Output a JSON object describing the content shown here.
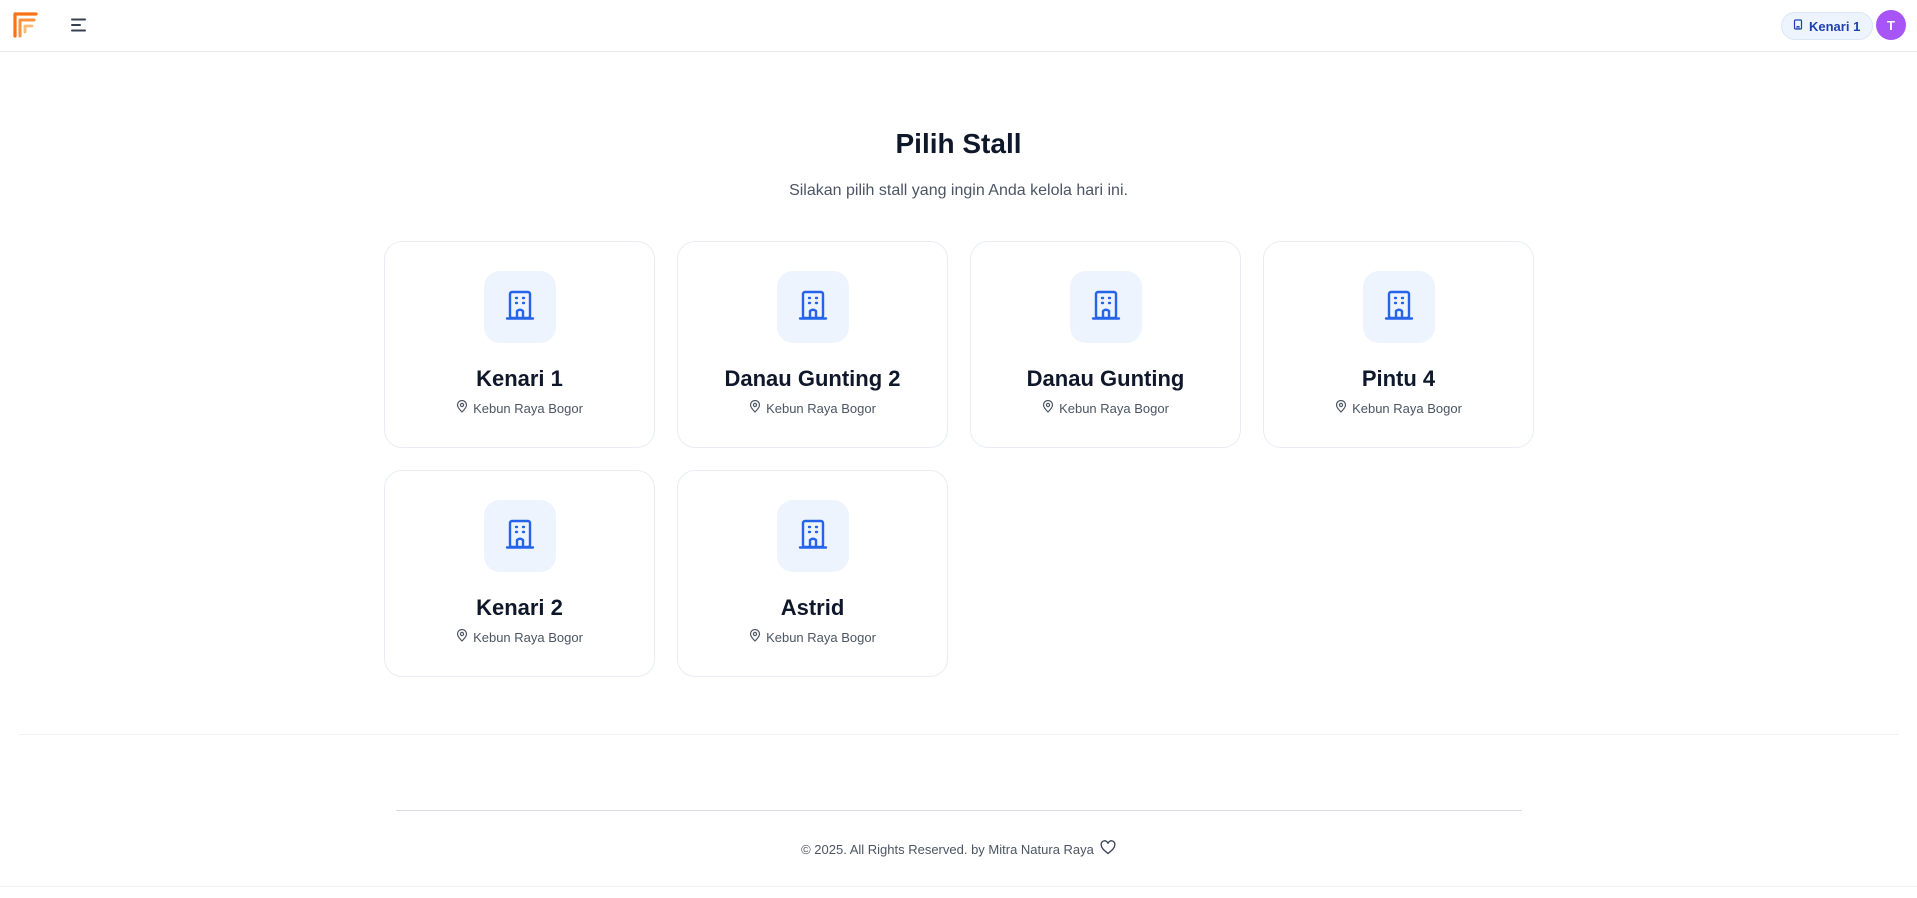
{
  "header": {
    "current_stall": "Kenari 1",
    "avatar_initial": "T"
  },
  "main": {
    "title": "Pilih Stall",
    "subtitle": "Silakan pilih stall yang ingin Anda kelola hari ini."
  },
  "stalls": [
    {
      "name": "Kenari 1",
      "location": "Kebun Raya Bogor"
    },
    {
      "name": "Danau Gunting 2",
      "location": "Kebun Raya Bogor"
    },
    {
      "name": "Danau Gunting",
      "location": "Kebun Raya Bogor"
    },
    {
      "name": "Pintu 4",
      "location": "Kebun Raya Bogor"
    },
    {
      "name": "Kenari 2",
      "location": "Kebun Raya Bogor"
    },
    {
      "name": "Astrid",
      "location": "Kebun Raya Bogor"
    }
  ],
  "footer": {
    "text": "© 2025. All Rights Reserved. by Mitra Natura Raya"
  },
  "icons": {
    "logo": "brand-logo-icon",
    "menu": "menu-icon",
    "stall_chip": "building-icon",
    "card": "building-icon",
    "location": "map-pin-icon",
    "footer": "heart-icon"
  },
  "colors": {
    "accent": "#2563eb",
    "logo": "#f97316",
    "avatar": "#a855f7",
    "icon_bg": "#eef4fd"
  }
}
